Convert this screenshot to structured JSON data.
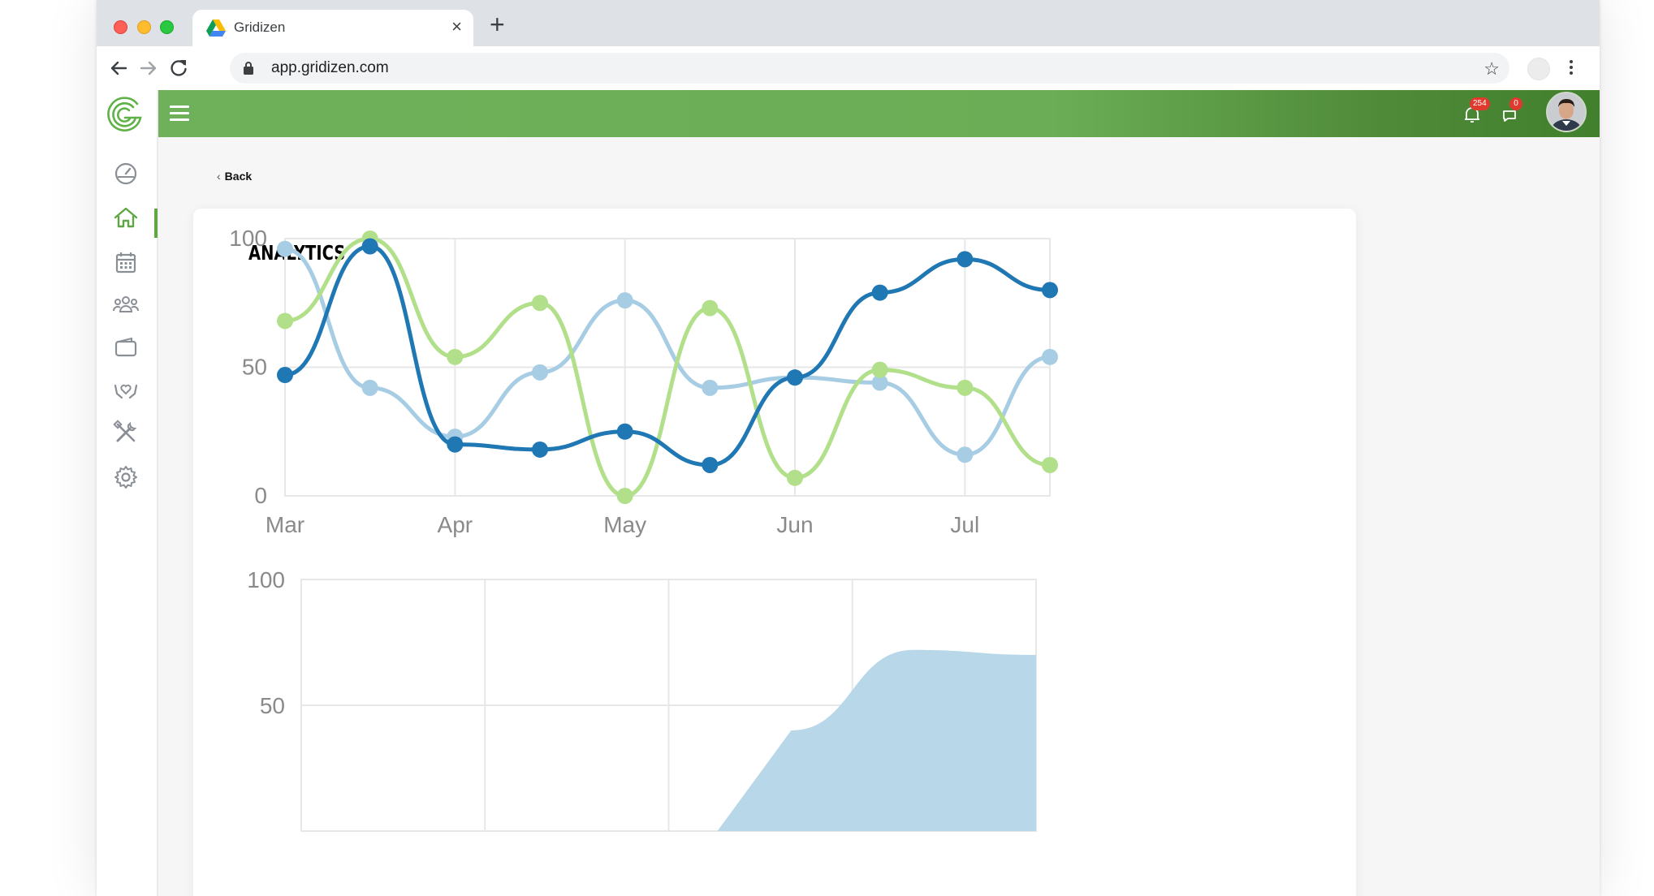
{
  "browser": {
    "tab_title": "Gridizen",
    "url": "app.gridizen.com",
    "close_glyph": "×",
    "new_tab_glyph": "+",
    "star_glyph": "☆"
  },
  "topbar": {
    "notifications_count": "254",
    "messages_count": "0"
  },
  "sidebar": {
    "items": [
      {
        "icon": "dashboard-gauge-icon"
      },
      {
        "icon": "home-icon",
        "active": true
      },
      {
        "icon": "calendar-icon"
      },
      {
        "icon": "people-group-icon"
      },
      {
        "icon": "wallet-icon"
      },
      {
        "icon": "heart-hands-icon"
      },
      {
        "icon": "tools-icon"
      },
      {
        "icon": "gear-icon"
      }
    ]
  },
  "page": {
    "back_label": "Back",
    "card_title": "ANALYTICS"
  },
  "colors": {
    "brand_green": "#6eb15a",
    "series_dark_blue": "#1f77b4",
    "series_light_blue": "#a6cde3",
    "series_light_green": "#b2df8a",
    "badge_red": "#e03a2e"
  },
  "chart_data": [
    {
      "type": "line",
      "curve": "smooth",
      "categories": [
        "Mar",
        "",
        "Apr",
        "",
        "May",
        "",
        "Jun",
        "",
        "Jul",
        ""
      ],
      "x_tick_labels": [
        "Mar",
        "Apr",
        "May",
        "Jun",
        "Jul"
      ],
      "y_tick_labels": [
        "0",
        "50",
        "100"
      ],
      "ylim": [
        0,
        100
      ],
      "grid": true,
      "series": [
        {
          "color": "#a6cde3",
          "values": [
            96,
            42,
            23,
            48,
            76,
            42,
            46,
            44,
            16,
            54
          ]
        },
        {
          "color": "#b2df8a",
          "values": [
            68,
            100,
            54,
            75,
            0,
            73,
            7,
            49,
            42,
            12
          ]
        },
        {
          "color": "#1f77b4",
          "values": [
            47,
            97,
            20,
            18,
            25,
            12,
            46,
            79,
            92,
            80
          ]
        }
      ]
    },
    {
      "type": "area",
      "y_tick_labels": [
        "50",
        "100"
      ],
      "ylim": [
        0,
        100
      ],
      "grid": true,
      "series": [
        {
          "color": "#b8d8ea",
          "values": [
            null,
            null,
            null,
            null,
            40,
            72,
            70
          ]
        }
      ]
    }
  ]
}
